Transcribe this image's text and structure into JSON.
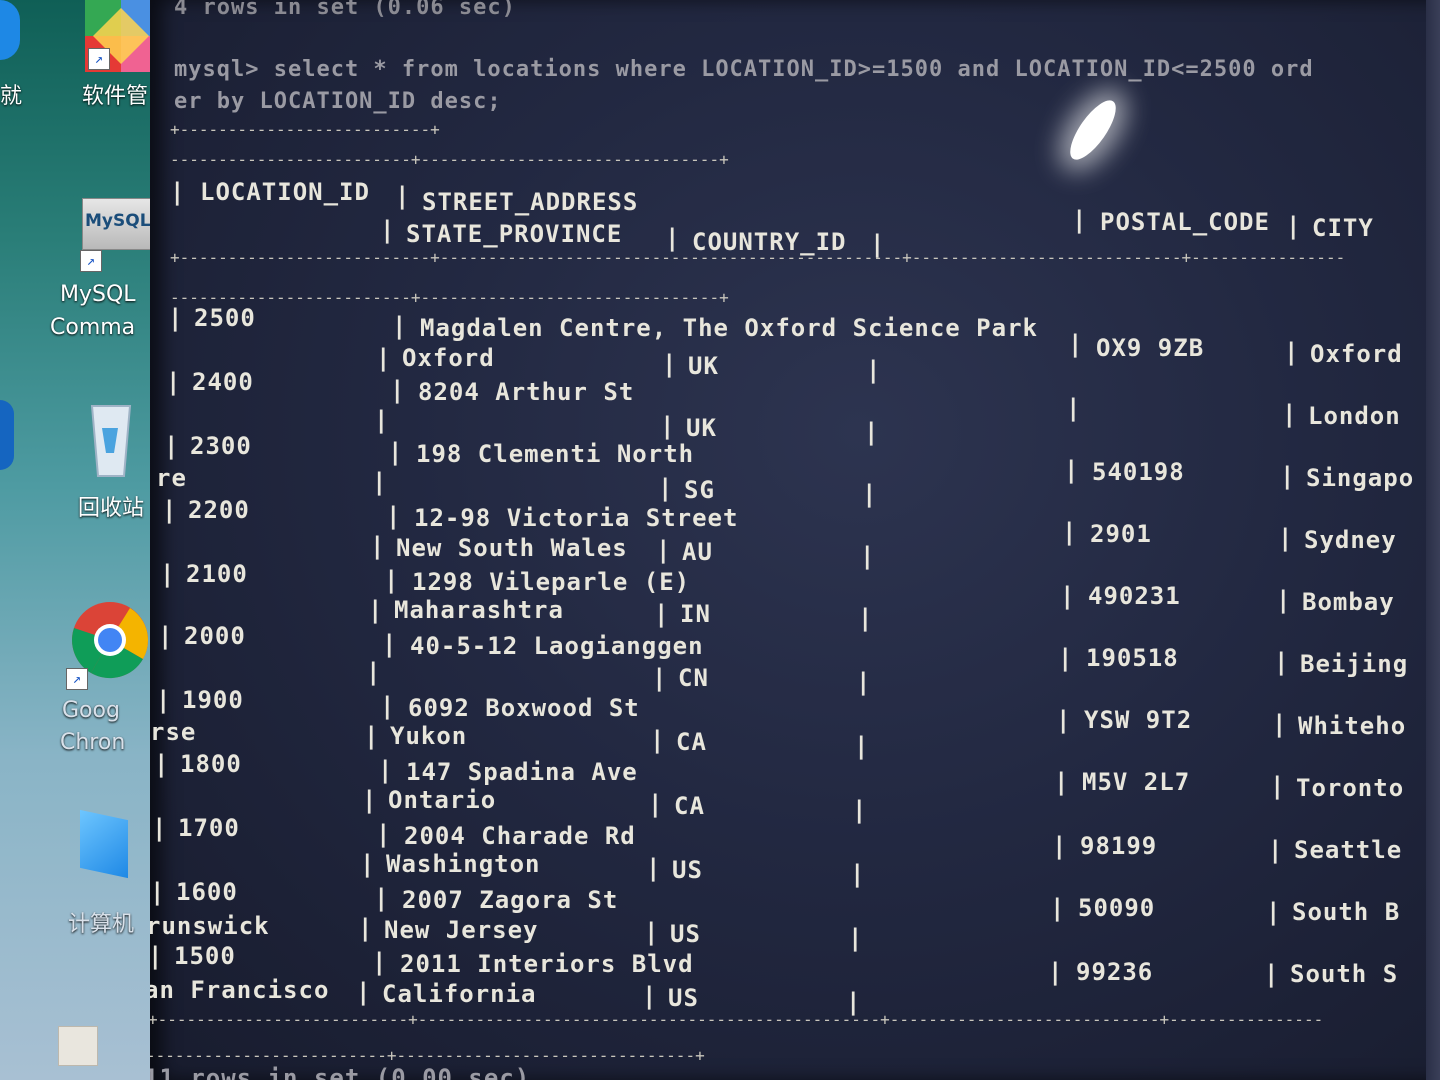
{
  "desktop": {
    "icons": [
      {
        "label": "软件管"
      },
      {
        "label": "MySQL"
      },
      {
        "label": "MySQL"
      },
      {
        "label": "Comma"
      },
      {
        "label": "回收站"
      },
      {
        "label": "Goog"
      },
      {
        "label": "Chron"
      },
      {
        "label": "计算机"
      }
    ]
  },
  "console": {
    "prev_result": "4 rows in set (0.06 sec)",
    "prompt_line": "mysql> select * from locations where LOCATION_ID>=1500 and LOCATION_ID<=2500 ord",
    "prompt_line_2": "er by LOCATION_ID desc;",
    "headers": {
      "location_id": "LOCATION_ID",
      "street_address": "STREET_ADDRESS",
      "postal_code": "POSTAL_CODE",
      "city": "CITY",
      "state_province": "STATE_PROVINCE",
      "country_id": "COUNTRY_ID"
    },
    "rows": [
      {
        "location_id": "2500",
        "street": "Magdalen Centre, The Oxford Science Park",
        "postal": "OX9 9ZB",
        "city": "Oxford",
        "wrap": "",
        "state": "Oxford",
        "country": "UK"
      },
      {
        "location_id": "2400",
        "street": "8204 Arthur St",
        "postal": "",
        "city": "London",
        "wrap": "",
        "state": "",
        "country": "UK"
      },
      {
        "location_id": "2300",
        "street": "198 Clementi North",
        "postal": "540198",
        "city": "Singapo",
        "wrap": "re",
        "state": "",
        "country": "SG"
      },
      {
        "location_id": "2200",
        "street": "12-98 Victoria Street",
        "postal": "2901",
        "city": "Sydney",
        "wrap": "",
        "state": "New South Wales",
        "country": "AU"
      },
      {
        "location_id": "2100",
        "street": "1298 Vileparle (E)",
        "postal": "490231",
        "city": "Bombay",
        "wrap": "",
        "state": "Maharashtra",
        "country": "IN"
      },
      {
        "location_id": "2000",
        "street": "40-5-12 Laogianggen",
        "postal": "190518",
        "city": "Beijing",
        "wrap": "",
        "state": "",
        "country": "CN"
      },
      {
        "location_id": "1900",
        "street": "6092 Boxwood St",
        "postal": "YSW 9T2",
        "city": "Whiteho",
        "wrap": "rse",
        "state": "Yukon",
        "country": "CA"
      },
      {
        "location_id": "1800",
        "street": "147 Spadina Ave",
        "postal": "M5V 2L7",
        "city": "Toronto",
        "wrap": "",
        "state": "Ontario",
        "country": "CA"
      },
      {
        "location_id": "1700",
        "street": "2004 Charade Rd",
        "postal": "98199",
        "city": "Seattle",
        "wrap": "",
        "state": "Washington",
        "country": "US"
      },
      {
        "location_id": "1600",
        "street": "2007 Zagora St",
        "postal": "50090",
        "city": "South B",
        "wrap": "runswick",
        "state": "New Jersey",
        "country": "US"
      },
      {
        "location_id": "1500",
        "street": "2011 Interiors Blvd",
        "postal": "99236",
        "city": "South S",
        "wrap": "an Francisco",
        "state": "California",
        "country": "US"
      }
    ],
    "footer_result": "11 rows in set (0.00 sec)"
  }
}
